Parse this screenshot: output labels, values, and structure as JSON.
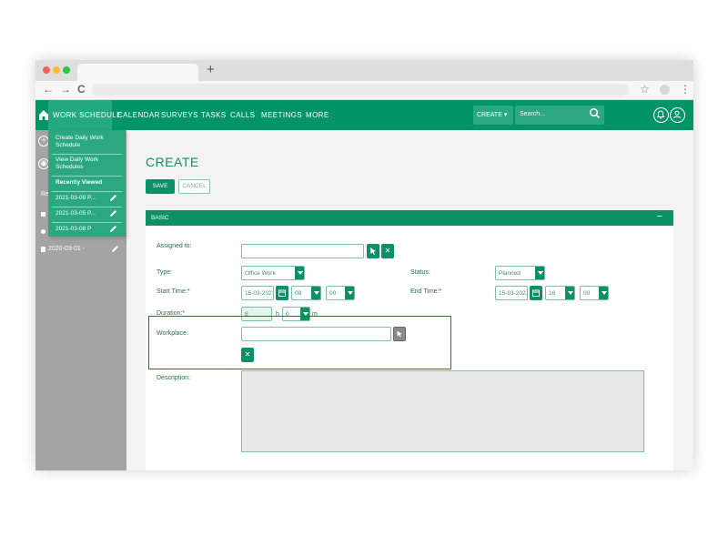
{
  "browser": {
    "new_tab_glyph": "+",
    "star_glyph": "☆",
    "menu_glyph": "⋮",
    "back_glyph": "←",
    "forward_glyph": "→",
    "reload_glyph": "C"
  },
  "nav": {
    "items": [
      "WORK SCHEDULE",
      "CALENDAR",
      "SURVEYS",
      "TASKS",
      "CALLS",
      "MEETINGS",
      "MORE"
    ],
    "create_label": "CREATE",
    "create_caret": "▾",
    "search_placeholder": "Search..."
  },
  "sidebar": {
    "letter_r": "Re",
    "recent_entry": "2020-03-01 -"
  },
  "dropdown": {
    "create_daily": "Create Daily Work Schedule",
    "view_daily": "View Daily Work Schedules",
    "recently_viewed": "Recently Viewed",
    "recent": [
      "2021-03-09 P...",
      "2021-03-05 P...",
      "2021-03-08 P"
    ]
  },
  "page": {
    "title": "CREATE",
    "save": "SAVE",
    "cancel": "CANCEL"
  },
  "panel": {
    "title": "BASIC",
    "minimize": "−"
  },
  "form": {
    "assigned_to_label": "Assigned to:",
    "type_label": "Type:",
    "type_value": "Office Work",
    "status_label": "Status:",
    "status_value": "Planned",
    "start_label": "Start Time:*",
    "start_date": "15-03-2021",
    "start_hour": "08",
    "start_min": "00",
    "end_label": "End Time:*",
    "end_date": "15-03-2021",
    "end_hour": "16",
    "end_min": "00",
    "duration_label": "Duration:*",
    "duration_value": "8",
    "duration_h": "h",
    "duration_min": "0",
    "duration_m": "m",
    "workplace_label": "Workplace:",
    "description_label": "Description:",
    "clear_glyph": "✕"
  }
}
